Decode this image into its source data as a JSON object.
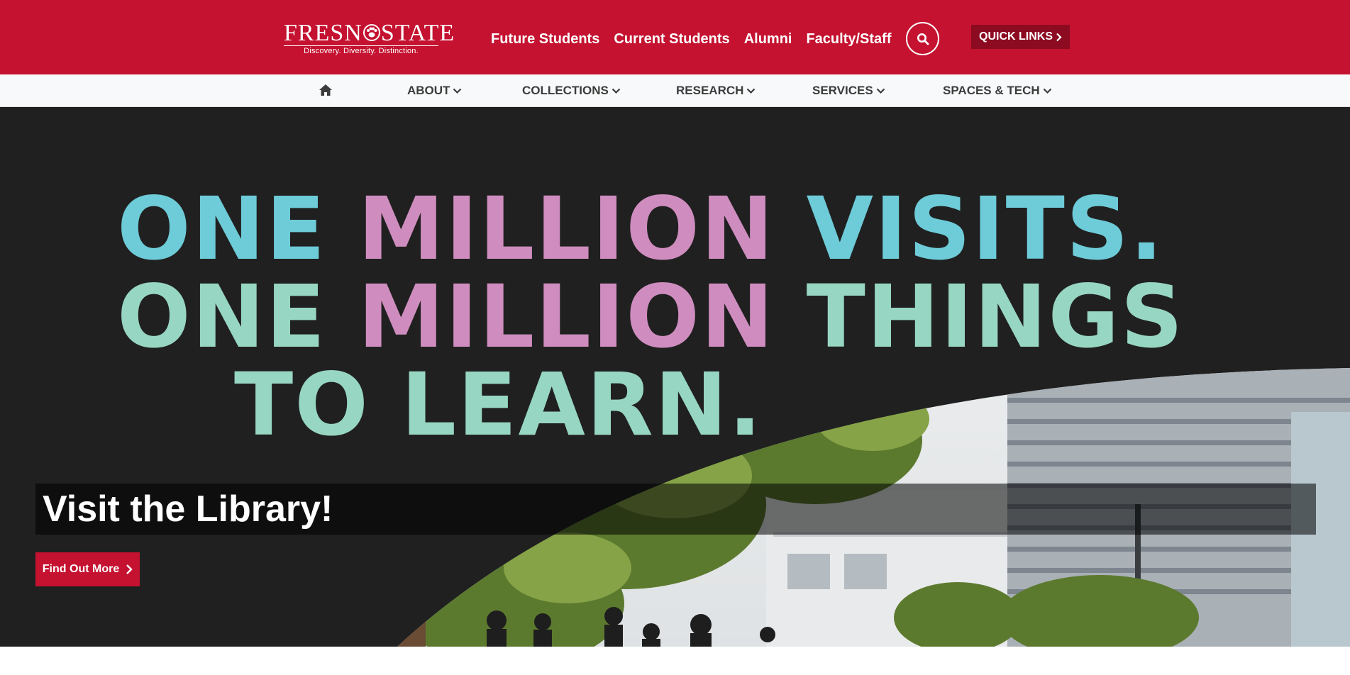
{
  "header": {
    "logo": {
      "wordmark": "FRESNOSTATE",
      "tagline": "Discovery. Diversity. Distinction."
    },
    "nav": [
      "Future Students",
      "Current Students",
      "Alumni",
      "Faculty/Staff"
    ],
    "search_icon": "search-icon",
    "quick_links_label": "QUICK LINKS"
  },
  "subnav": {
    "home_icon": "home-icon",
    "items": [
      "ABOUT",
      "COLLECTIONS",
      "RESEARCH",
      "SERVICES",
      "SPACES & TECH"
    ]
  },
  "hero": {
    "headline": {
      "line1": [
        "ONE",
        "MILLION",
        "VISITS."
      ],
      "line2": [
        "ONE",
        "MILLION",
        "THINGS"
      ],
      "line3": "TO LEARN."
    },
    "caption": "Visit the Library!",
    "cta_label": "Find Out More"
  },
  "colors": {
    "brand_red": "#c41230",
    "quick_links_bg": "#8c0b21",
    "headline_blue": "#6ecbd8",
    "headline_pink": "#cf8dbf",
    "headline_mint": "#97d6c2",
    "hero_bg": "#202020"
  }
}
